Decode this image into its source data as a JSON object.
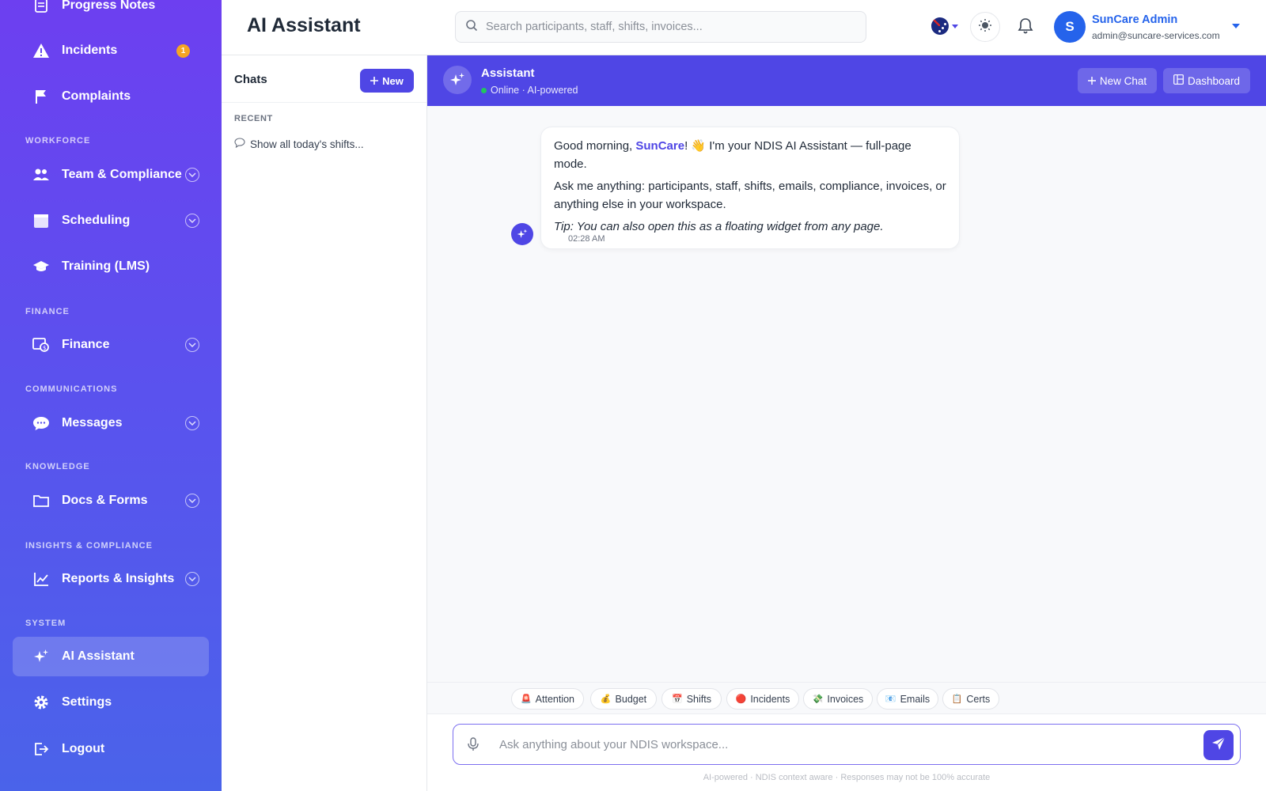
{
  "sidebar": {
    "items": [
      {
        "label": "Progress Notes",
        "icon": "notes-icon"
      },
      {
        "label": "Incidents",
        "icon": "warning-icon",
        "badge": "1"
      },
      {
        "label": "Complaints",
        "icon": "flag-icon"
      },
      {
        "label": "Team & Compliance",
        "icon": "team-icon"
      },
      {
        "label": "Scheduling",
        "icon": "calendar-icon"
      },
      {
        "label": "Training (LMS)",
        "icon": "graduation-cap-icon"
      },
      {
        "label": "Finance",
        "icon": "finance-icon"
      },
      {
        "label": "Messages",
        "icon": "chat-bubble-icon"
      },
      {
        "label": "Docs & Forms",
        "icon": "folder-icon"
      },
      {
        "label": "Reports & Insights",
        "icon": "chart-line-icon"
      },
      {
        "label": "AI Assistant",
        "icon": "sparkle-icon",
        "active": true
      },
      {
        "label": "Settings",
        "icon": "gear-icon"
      },
      {
        "label": "Logout",
        "icon": "logout-icon"
      }
    ],
    "sections": {
      "workforce": "WORKFORCE",
      "finance": "FINANCE",
      "communications": "COMMUNICATIONS",
      "knowledge": "KNOWLEDGE",
      "insights": "INSIGHTS & COMPLIANCE",
      "system": "SYSTEM"
    }
  },
  "header": {
    "title": "AI Assistant",
    "search_placeholder": "Search participants, staff, shifts, invoices...",
    "user": {
      "initial": "S",
      "name": "SunCare Admin",
      "email": "admin@suncare-services.com"
    }
  },
  "chats": {
    "title": "Chats",
    "new_label": "New",
    "recent_label": "RECENT",
    "items": [
      {
        "label": "Show all today's shifts..."
      }
    ]
  },
  "assistant": {
    "name": "Assistant",
    "status": "Online · AI-powered",
    "new_chat_label": "New Chat",
    "dashboard_label": "Dashboard"
  },
  "message": {
    "greeting_pre": "Good morning, ",
    "brand": "SunCare",
    "greeting_post": "! 👋 I'm your NDIS AI Assistant — full-page mode.",
    "line2": "Ask me anything: participants, staff, shifts, emails, compliance, invoices, or anything else in your workspace.",
    "tip": "Tip: You can also open this as a floating widget from any page.",
    "time": "02:28 AM"
  },
  "chips": [
    {
      "emoji": "🚨",
      "label": "Attention"
    },
    {
      "emoji": "💰",
      "label": "Budget"
    },
    {
      "emoji": "📅",
      "label": "Shifts"
    },
    {
      "emoji": "🔴",
      "label": "Incidents"
    },
    {
      "emoji": "💸",
      "label": "Invoices"
    },
    {
      "emoji": "📧",
      "label": "Emails"
    },
    {
      "emoji": "📋",
      "label": "Certs"
    }
  ],
  "composer": {
    "placeholder": "Ask anything about your NDIS workspace...",
    "disclaimer": "AI-powered · NDIS context aware · Responses may not be 100% accurate"
  },
  "colors": {
    "accent": "#4f46e5",
    "sidebar_top": "#6d3ff0",
    "sidebar_bottom": "#4a63ea",
    "badge": "#f5a524",
    "user_blue": "#2563eb",
    "online": "#22c55e"
  }
}
